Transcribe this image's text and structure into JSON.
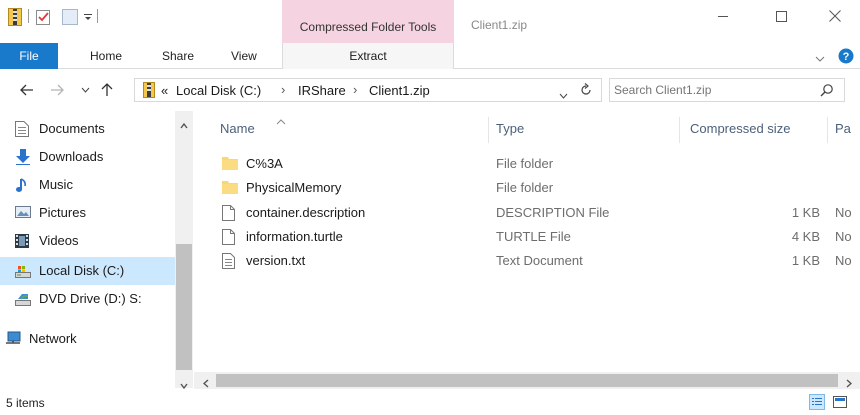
{
  "colors": {
    "accent": "#1979ca",
    "context_tab": "#f6d3e0",
    "selection": "#cce8ff",
    "folder": "#f8d775"
  },
  "titlebar": {
    "context_tab_label": "Compressed Folder Tools",
    "window_title": "Client1.zip",
    "qat_icons": [
      "folder-zip-icon",
      "properties-check-icon",
      "new-folder-icon",
      "customize-dropdown-icon"
    ],
    "window_buttons": [
      "minimize-icon",
      "maximize-icon",
      "close-icon"
    ]
  },
  "ribbon": {
    "file_label": "File",
    "tabs": [
      "Home",
      "Share",
      "View"
    ],
    "context_tab": "Extract",
    "help_icon": "help-icon"
  },
  "address": {
    "overflow": "«",
    "crumbs": [
      "Local Disk (C:)",
      "IRShare",
      "Client1.zip"
    ],
    "separator": "›",
    "search_placeholder": "Search Client1.zip"
  },
  "nav": {
    "items": [
      {
        "label": "Documents",
        "icon": "documents-icon"
      },
      {
        "label": "Downloads",
        "icon": "downloads-icon"
      },
      {
        "label": "Music",
        "icon": "music-icon"
      },
      {
        "label": "Pictures",
        "icon": "pictures-icon"
      },
      {
        "label": "Videos",
        "icon": "videos-icon"
      },
      {
        "label": "Local Disk (C:)",
        "icon": "local-disk-icon",
        "selected": true
      },
      {
        "label": "DVD Drive (D:) S:",
        "icon": "dvd-drive-icon"
      },
      {
        "label": "Network",
        "icon": "network-icon"
      }
    ]
  },
  "columns": {
    "name": "Name",
    "type": "Type",
    "size": "Compressed size",
    "extra": "Pa"
  },
  "files": [
    {
      "name": "C%3A",
      "type": "File folder",
      "size": "",
      "extra": "",
      "icon": "folder-icon"
    },
    {
      "name": "PhysicalMemory",
      "type": "File folder",
      "size": "",
      "extra": "",
      "icon": "folder-icon"
    },
    {
      "name": "container.description",
      "type": "DESCRIPTION File",
      "size": "1 KB",
      "extra": "No",
      "icon": "file-icon"
    },
    {
      "name": "information.turtle",
      "type": "TURTLE File",
      "size": "4 KB",
      "extra": "No",
      "icon": "file-icon"
    },
    {
      "name": "version.txt",
      "type": "Text Document",
      "size": "1 KB",
      "extra": "No",
      "icon": "text-file-icon"
    }
  ],
  "status": {
    "item_count": "5 items"
  }
}
